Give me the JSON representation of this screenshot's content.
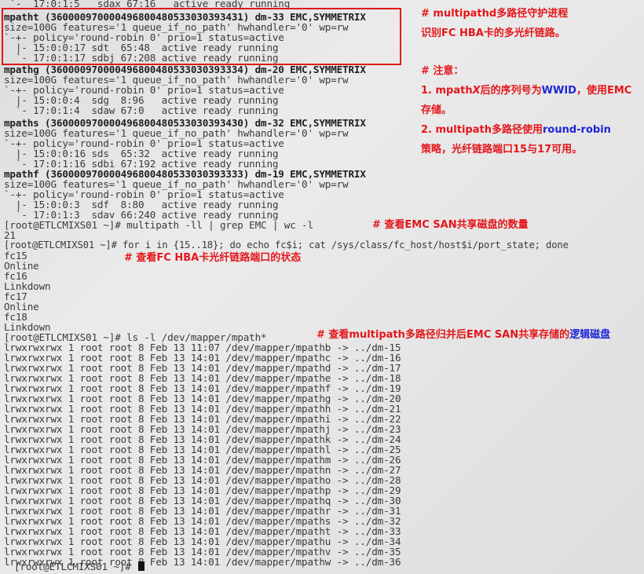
{
  "terminal": {
    "lines": [
      " `-  17:0:1:5   sdax 67:16   active ready running",
      "mpatht (360000970000496800480533030393431) dm-33 EMC,SYMMETRIX",
      "size=100G features='1 queue_if_no_path' hwhandler='0' wp=rw",
      "`-+- policy='round-robin 0' prio=1 status=active",
      "  |- 15:0:0:17 sdt  65:48  active ready running",
      "  `- 17:0:1:17 sdbj 67:208 active ready running",
      "mpathg (360000970000496800480533030393334) dm-20 EMC,SYMMETRIX",
      "size=100G features='1 queue_if_no_path' hwhandler='0' wp=rw",
      "`-+- policy='round-robin 0' prio=1 status=active",
      "  |- 15:0:0:4  sdg  8:96   active ready running",
      "  `- 17:0:1:4  sdaw 67:0   active ready running",
      "mpaths (360000970000496800480533030393430) dm-32 EMC,SYMMETRIX",
      "size=100G features='1 queue_if_no_path' hwhandler='0' wp=rw",
      "`-+- policy='round-robin 0' prio=1 status=active",
      "  |- 15:0:0:16 sds  65:32  active ready running",
      "  `- 17:0:1:16 sdbi 67:192 active ready running",
      "mpathf (360000970000496800480533030393333) dm-19 EMC,SYMMETRIX",
      "size=100G features='1 queue_if_no_path' hwhandler='0' wp=rw",
      "`-+- policy='round-robin 0' prio=1 status=active",
      "  |- 15:0:0:3  sdf  8:80   active ready running",
      "  `- 17:0:1:3  sdav 66:240 active ready running",
      "[root@ETLCMIXS01 ~]# multipath -ll | grep EMC | wc -l",
      "21",
      "[root@ETLCMIXS01 ~]# for i in {15..18}; do echo fc$i; cat /sys/class/fc_host/host$i/port_state; done",
      "fc15",
      "Online",
      "fc16",
      "Linkdown",
      "fc17",
      "Online",
      "fc18",
      "Linkdown",
      "[root@ETLCMIXS01 ~]# ls -l /dev/mapper/mpath*",
      "lrwxrwxrwx 1 root root 8 Feb 13 11:07 /dev/mapper/mpathb -> ../dm-15",
      "lrwxrwxrwx 1 root root 8 Feb 13 14:01 /dev/mapper/mpathc -> ../dm-16",
      "lrwxrwxrwx 1 root root 8 Feb 13 14:01 /dev/mapper/mpathd -> ../dm-17",
      "lrwxrwxrwx 1 root root 8 Feb 13 14:01 /dev/mapper/mpathe -> ../dm-18",
      "lrwxrwxrwx 1 root root 8 Feb 13 14:01 /dev/mapper/mpathf -> ../dm-19",
      "lrwxrwxrwx 1 root root 8 Feb 13 14:01 /dev/mapper/mpathg -> ../dm-20",
      "lrwxrwxrwx 1 root root 8 Feb 13 14:01 /dev/mapper/mpathh -> ../dm-21",
      "lrwxrwxrwx 1 root root 8 Feb 13 14:01 /dev/mapper/mpathi -> ../dm-22",
      "lrwxrwxrwx 1 root root 8 Feb 13 14:01 /dev/mapper/mpathj -> ../dm-23",
      "lrwxrwxrwx 1 root root 8 Feb 13 14:01 /dev/mapper/mpathk -> ../dm-24",
      "lrwxrwxrwx 1 root root 8 Feb 13 14:01 /dev/mapper/mpathl -> ../dm-25",
      "lrwxrwxrwx 1 root root 8 Feb 13 14:01 /dev/mapper/mpathm -> ../dm-26",
      "lrwxrwxrwx 1 root root 8 Feb 13 14:01 /dev/mapper/mpathn -> ../dm-27",
      "lrwxrwxrwx 1 root root 8 Feb 13 14:01 /dev/mapper/mpatho -> ../dm-28",
      "lrwxrwxrwx 1 root root 8 Feb 13 14:01 /dev/mapper/mpathp -> ../dm-29",
      "lrwxrwxrwx 1 root root 8 Feb 13 14:01 /dev/mapper/mpathq -> ../dm-30",
      "lrwxrwxrwx 1 root root 8 Feb 13 14:01 /dev/mapper/mpathr -> ../dm-31",
      "lrwxrwxrwx 1 root root 8 Feb 13 14:01 /dev/mapper/mpaths -> ../dm-32",
      "lrwxrwxrwx 1 root root 8 Feb 13 14:01 /dev/mapper/mpatht -> ../dm-33",
      "lrwxrwxrwx 1 root root 8 Feb 13 14:01 /dev/mapper/mpathu -> ../dm-34",
      "lrwxrwxrwx 1 root root 8 Feb 13 14:01 /dev/mapper/mpathv -> ../dm-35",
      "lrwxrwxrwx 1 root root 8 Feb 13 14:01 /dev/mapper/mpathw -> ../dm-36",
      "[root@ETLCMIXS01 ~]# "
    ]
  },
  "annotations": {
    "a1_line1": "# multipathd多路径守护进程",
    "a1_line2": "识别FC HBA卡的多光纤链路。",
    "notes_title": "# 注意：",
    "note1_a": "1. mpath",
    "note1_b": "X",
    "note1_c": "后的序列号为",
    "note1_d": "WWID",
    "note1_e": "，使用EMC",
    "note1_f": "存储。",
    "note2_a": "2. multipath多路径使用",
    "note2_b": "round-robin",
    "note2_c": "策略，光纤链路端口15与17可用。",
    "c_wc": "# 查看EMC SAN共享磁盘的数量",
    "c_fc": "# 查看FC HBA卡光纤链路端口的状态",
    "c_ls_a": "# 查看multipath多路径归并后EMC SAN共享存储的",
    "c_ls_b": "逻辑磁盘"
  },
  "colors": {
    "annotation_red": "#e4161b",
    "annotation_blue": "#1f25d8",
    "highlight_border": "#e01818"
  }
}
